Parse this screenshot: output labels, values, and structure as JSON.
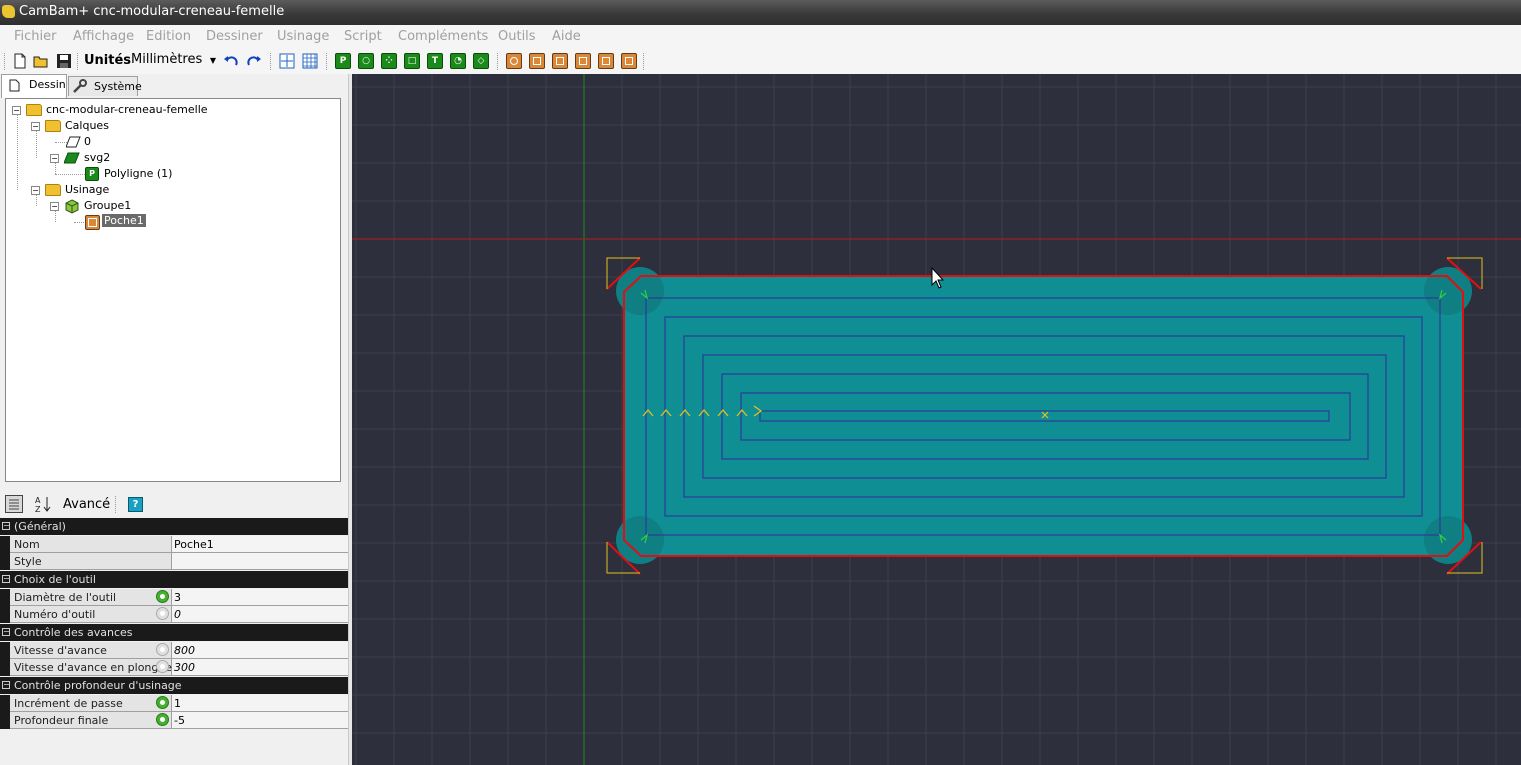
{
  "window": {
    "title": "CamBam+  cnc-modular-creneau-femelle"
  },
  "menu": [
    "Fichier",
    "Affichage",
    "Edition",
    "Dessiner",
    "Usinage",
    "Script",
    "Compléments",
    "Outils",
    "Aide"
  ],
  "toolbar": {
    "units_label": "Unités",
    "units_value": "Millimètres",
    "green_tools": [
      "P",
      "",
      "",
      "",
      "T",
      "",
      ""
    ]
  },
  "tabs": {
    "drawing": "Dessin",
    "system": "Système"
  },
  "tree": {
    "root": "cnc-modular-creneau-femelle",
    "layers": "Calques",
    "layer0": "0",
    "svg2": "svg2",
    "polyline": "Polyligne (1)",
    "machining": "Usinage",
    "group1": "Groupe1",
    "pocket1": "Poche1"
  },
  "properties": {
    "advanced_label": "Avancé",
    "help": "?",
    "cat_general": "(Général)",
    "name_label": "Nom",
    "name_value": "Poche1",
    "style_label": "Style",
    "style_value": "",
    "cat_tool": "Choix de l'outil",
    "tool_diameter_label": "Diamètre de l'outil",
    "tool_diameter_value": "3",
    "tool_number_label": "Numéro d'outil",
    "tool_number_value": "0",
    "cat_feed": "Contrôle des avances",
    "feed_rate_label": "Vitesse d'avance",
    "feed_rate_value": "800",
    "plunge_rate_label": "Vitesse d'avance en plongée",
    "plunge_rate_value": "300",
    "cat_depth": "Contrôle profondeur d'usinage",
    "depth_increment_label": "Incrément de passe",
    "depth_increment_value": "1",
    "target_depth_label": "Profondeur finale",
    "target_depth_value": "-5"
  },
  "colors": {
    "canvas_bg": "#2e2f3d",
    "grid": "#3d3f4e",
    "pocket_fill": "#0f8f94",
    "toolpath": "#2a3a9a",
    "outline": "#e01010",
    "y_axis": "#1f8a1f",
    "x_axis": "#b01c1c",
    "marker": "#e0c020"
  }
}
